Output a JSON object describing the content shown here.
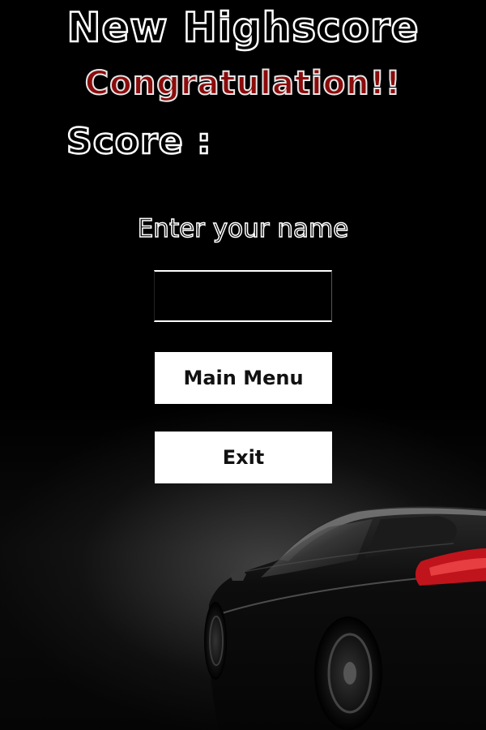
{
  "screen": {
    "title": "New Highscore",
    "subtitle": "Congratulation!!",
    "score_label": "Score :",
    "score_value": "",
    "name_prompt": "Enter your name"
  },
  "name_input": {
    "value": "",
    "placeholder": ""
  },
  "buttons": {
    "main_menu": "Main Menu",
    "exit": "Exit"
  },
  "colors": {
    "background": "#000000",
    "title_outline": "#ffffff",
    "subtitle_fill": "#8a0b0b",
    "button_bg": "#ffffff",
    "button_text": "#111111",
    "taillight": "#c0141c"
  },
  "background_image": "black-sports-car"
}
